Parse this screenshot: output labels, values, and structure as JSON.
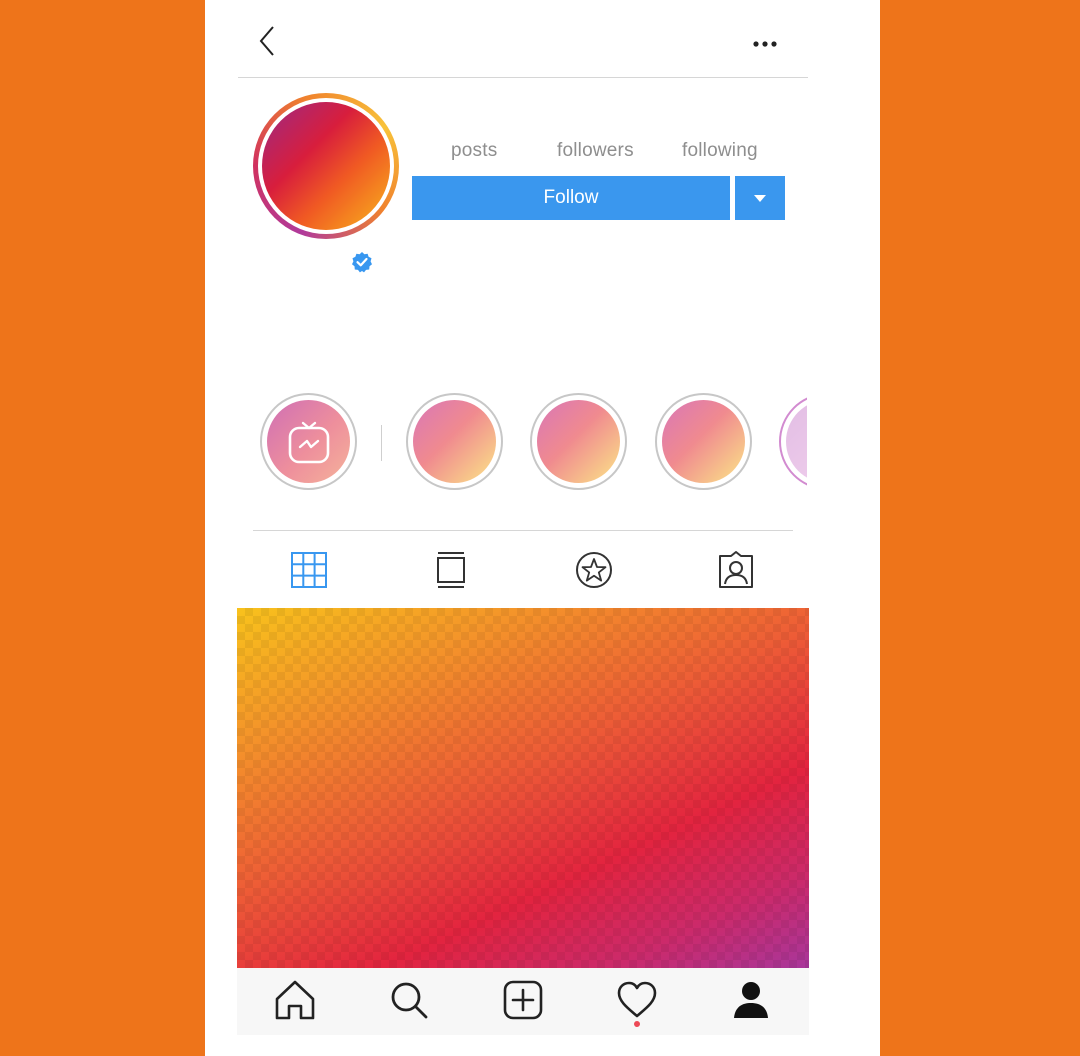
{
  "header": {
    "back_icon": "chevron-left-icon",
    "more_icon": "more-horizontal-icon"
  },
  "profile": {
    "avatar_gradient": [
      "#9b2a86",
      "#d81e3c",
      "#f05a23",
      "#f9b71c"
    ],
    "verified_icon": "verified-badge-icon",
    "verified_color": "#3897f0"
  },
  "stats": {
    "posts_label": "posts",
    "followers_label": "followers",
    "following_label": "following"
  },
  "actions": {
    "follow_label": "Follow",
    "dropdown_icon": "caret-down-icon",
    "accent_color": "#3a97ee"
  },
  "highlights": [
    {
      "icon": "igtv-icon"
    },
    {
      "icon": "highlight-cover"
    },
    {
      "icon": "highlight-cover"
    },
    {
      "icon": "highlight-cover"
    },
    {
      "icon": "highlight-cover"
    }
  ],
  "tabs": [
    {
      "icon": "grid-icon",
      "active": true
    },
    {
      "icon": "igtv-tab-icon",
      "active": false
    },
    {
      "icon": "star-icon",
      "active": false
    },
    {
      "icon": "tagged-icon",
      "active": false
    }
  ],
  "bottom_nav": [
    {
      "icon": "home-icon"
    },
    {
      "icon": "search-icon"
    },
    {
      "icon": "add-post-icon"
    },
    {
      "icon": "heart-icon",
      "notification_dot": true
    },
    {
      "icon": "profile-icon"
    }
  ],
  "colors": {
    "background": "#EE741A",
    "active_tab": "#3897f0",
    "notification": "#ed4956"
  }
}
